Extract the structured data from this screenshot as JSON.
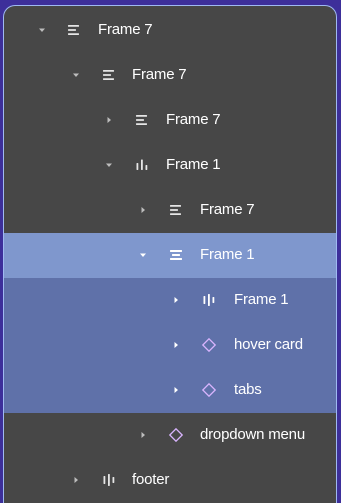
{
  "layers": [
    {
      "label": "Frame 7",
      "icon": "align-left-icon",
      "expanded": true,
      "depth": 0
    },
    {
      "label": "Frame 7",
      "icon": "align-left-icon",
      "expanded": true,
      "depth": 1
    },
    {
      "label": "Frame 7",
      "icon": "align-left-icon",
      "expanded": false,
      "depth": 2
    },
    {
      "label": "Frame 1",
      "icon": "align-bottom-icon",
      "expanded": true,
      "depth": 2
    },
    {
      "label": "Frame 7",
      "icon": "align-left-icon",
      "expanded": false,
      "depth": 3
    },
    {
      "label": "Frame 1",
      "icon": "align-center-icon",
      "expanded": true,
      "depth": 3,
      "state": "selected"
    },
    {
      "label": "Frame 1",
      "icon": "align-middle-icon",
      "expanded": false,
      "depth": 4,
      "state": "child-selected"
    },
    {
      "label": "hover card",
      "icon": "component-instance-icon",
      "expanded": false,
      "depth": 4,
      "state": "child-selected"
    },
    {
      "label": "tabs",
      "icon": "component-instance-icon",
      "expanded": false,
      "depth": 4,
      "state": "child-selected"
    },
    {
      "label": "dropdown menu",
      "icon": "component-instance-icon",
      "expanded": false,
      "depth": 3
    },
    {
      "label": "footer",
      "icon": "align-middle-icon",
      "expanded": false,
      "depth": 1
    }
  ],
  "colors": {
    "panel": "#474747",
    "selected": "#7f97cd",
    "child_selected": "#5f71a9",
    "component": "#d8b4fe",
    "border": "#9fb9f2"
  }
}
